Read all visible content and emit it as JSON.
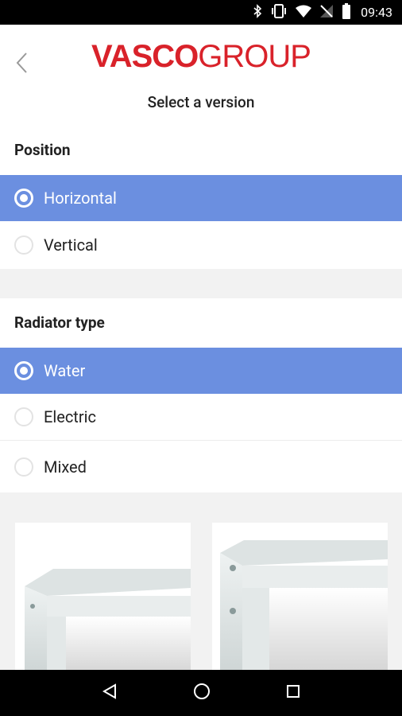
{
  "status_bar": {
    "time": "09:43"
  },
  "header": {
    "logo_bold": "VASCO",
    "logo_light": "GROUP",
    "subtitle": "Select a version"
  },
  "position": {
    "title": "Position",
    "options": [
      {
        "label": "Horizontal",
        "selected": true
      },
      {
        "label": "Vertical",
        "selected": false
      }
    ]
  },
  "radiator_type": {
    "title": "Radiator type",
    "options": [
      {
        "label": "Water",
        "selected": true
      },
      {
        "label": "Electric",
        "selected": false
      },
      {
        "label": "Mixed",
        "selected": false
      }
    ]
  },
  "colors": {
    "accent": "#6b8fe0",
    "brand": "#d9222a"
  }
}
